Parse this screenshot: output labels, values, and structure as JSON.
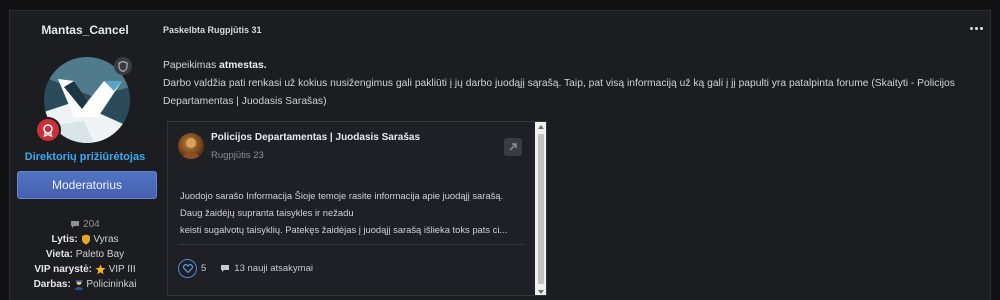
{
  "author": {
    "name": "Mantas_Cancel",
    "group": "Direktorių prižiūrėtojas",
    "role_button": "Moderatorius",
    "stats": {
      "posts_count": "204",
      "gender_label": "Lytis:",
      "gender_value": "Vyras",
      "location_label": "Vieta:",
      "location_value": "Paleto Bay",
      "vip_label": "VIP narystė:",
      "vip_value": "VIP III",
      "job_label": "Darbas:",
      "job_value": "Policininkai"
    }
  },
  "post": {
    "meta": "Paskelbta Rugpjūtis 31",
    "line1_prefix": "Papeikimas ",
    "line1_bold": "atmestas.",
    "line2": "Darbo valdžia pati renkasi už kokius nusižengimus gali pakliūti į jų darbo juodąjį sąrašą. Taip, pat visą informaciją už ką gali į jį papulti yra patalpinta forume (Skaityti - Policijos",
    "line3": "Departamentas | Juodasis Sarašas)"
  },
  "embed": {
    "title": "Policijos Departamentas | Juodasis Sarašas",
    "date": "Rugpjūtis 23",
    "body_lines": [
      "Juodojo sarašo Informacija Šioje temoje rasite informacija apie juodąjį sarašą.",
      "Daug žaidėjų supranta taisykles ir nežadu",
      "keisti sugalvotų taisyklių. Patekęs žaidėjas į juodąjį sarašą išlieka toks pats ci..."
    ],
    "likes": "5",
    "replies": "13 nauji atsakymai"
  },
  "colors": {
    "accent_blue": "#3fa7ec",
    "role_button": "#4f6bbf",
    "rank_badge": "#c9303a"
  },
  "icons": [
    "shield-icon",
    "rank-badge-icon",
    "comment-icon",
    "shield-emoji-icon",
    "star-icon",
    "police-icon",
    "share-icon",
    "heart-icon",
    "more-icon"
  ]
}
